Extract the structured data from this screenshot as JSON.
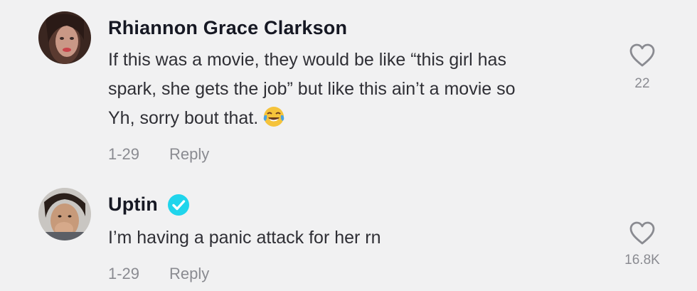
{
  "comments": [
    {
      "author": "Rhiannon Grace Clarkson",
      "verified": false,
      "lines": [
        "If this was a movie, they would be like “this girl has",
        "spark, she gets the job” but like this ain’t a movie so",
        "Yh, sorry bout that."
      ],
      "emoji": "face-with-tears-of-joy-icon",
      "date": "1-29",
      "reply_label": "Reply",
      "likes": "22"
    },
    {
      "author": "Uptin",
      "verified": true,
      "lines": [
        "I’m having a panic attack for her rn"
      ],
      "date": "1-29",
      "reply_label": "Reply",
      "likes": "16.8K"
    }
  ],
  "colors": {
    "background": "#f1f1f2",
    "author_text": "#161823",
    "body_text": "#2f2f35",
    "meta_text": "#8a8b91",
    "verified_badge": "#20d5ec"
  }
}
